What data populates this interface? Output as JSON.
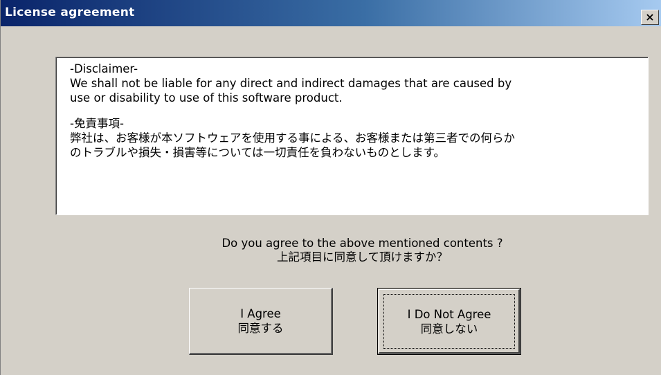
{
  "window": {
    "title": "License agreement",
    "close_glyph": "×"
  },
  "agreement_text": {
    "disclaimer_en": "-Disclaimer-\nWe shall not be liable for any direct and indirect damages that are caused by\nuse or disability to use of this software product.",
    "disclaimer_ja": "-免責事項-\n弊社は、お客様が本ソフトウェアを使用する事による、お客様または第三者での何らか\nのトラブルや損失・損害等については一切責任を負わないものとします。"
  },
  "question": {
    "en": "Do you agree to the above mentioned contents ?",
    "ja": "上記項目に同意して頂けますか？"
  },
  "buttons": {
    "agree_en": "I Agree",
    "agree_ja": "同意する",
    "disagree_en": "I Do Not Agree",
    "disagree_ja": "同意しない"
  },
  "colors": {
    "titlebar_start": "#0a246a",
    "titlebar_end": "#a6caf0",
    "face": "#d4d0c8"
  }
}
